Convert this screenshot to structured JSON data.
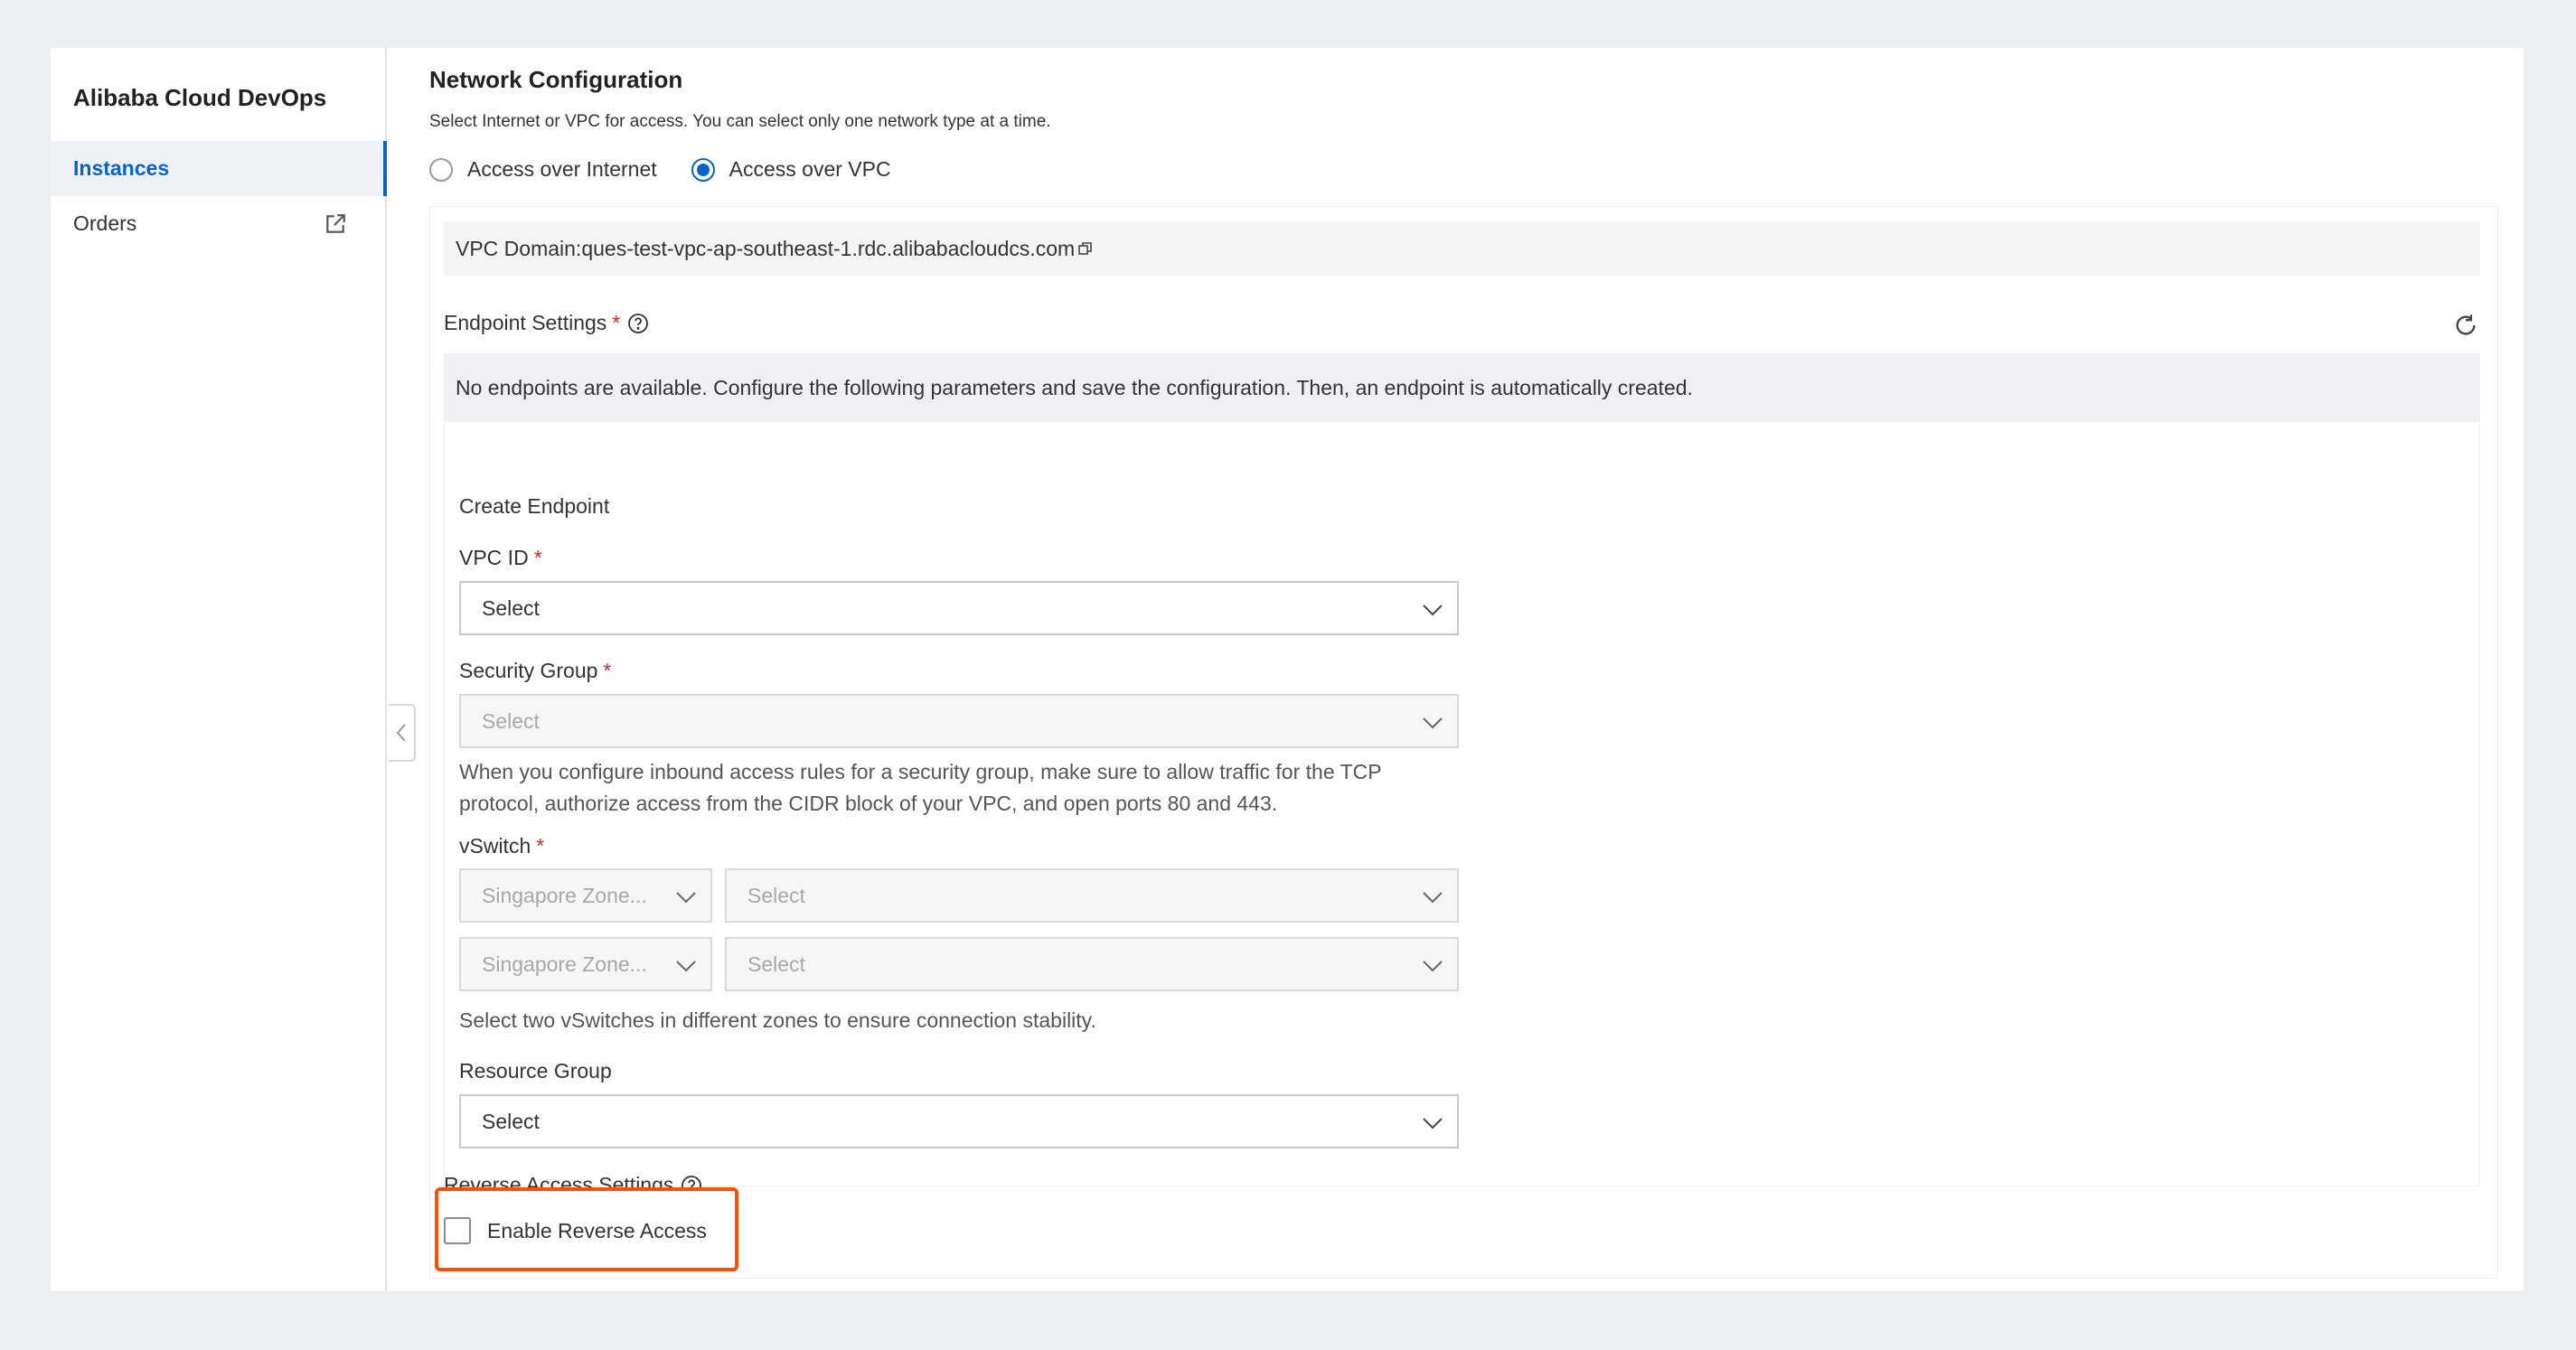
{
  "sidebar": {
    "brand": "Alibaba Cloud DevOps",
    "items": [
      {
        "label": "Instances",
        "active": true
      },
      {
        "label": "Orders",
        "active": false,
        "icon": "external-link-icon"
      }
    ]
  },
  "network": {
    "title": "Network Configuration",
    "description": "Select Internet or VPC for access. You can select only one network type at a time.",
    "options": [
      {
        "label": "Access over Internet",
        "checked": false
      },
      {
        "label": "Access over VPC",
        "checked": true
      }
    ],
    "vpc_domain": "VPC Domain:ques-test-vpc-ap-southeast-1.rdc.alibabacloudcs.com"
  },
  "endpoint": {
    "title": "Endpoint Settings",
    "required_mark": "*",
    "notice": "No endpoints are available. Configure the following parameters and save the configuration. Then, an endpoint is automatically created.",
    "create_title": "Create Endpoint",
    "vpc_id": {
      "label": "VPC ID",
      "placeholder": "Select"
    },
    "security_group": {
      "label": "Security Group",
      "placeholder": "Select",
      "hint_line1": "When you configure inbound access rules for a security group, make sure to allow traffic for the TCP",
      "hint_line2": "protocol, authorize access from the CIDR block of your VPC, and open ports 80 and 443."
    },
    "vswitch": {
      "label": "vSwitch",
      "zone1": "Singapore Zone...",
      "select1": "Select",
      "zone2": "Singapore Zone...",
      "select2": "Select",
      "hint": "Select two vSwitches in different zones to ensure connection stability."
    },
    "resource_group": {
      "label": "Resource Group",
      "placeholder": "Select"
    }
  },
  "reverse": {
    "title": "Reverse Access Settings",
    "checkbox_label": "Enable Reverse Access",
    "checked": false
  },
  "colors": {
    "accent": "#0a64c8",
    "required": "#d4281f",
    "highlight": "#ff4d0a"
  }
}
